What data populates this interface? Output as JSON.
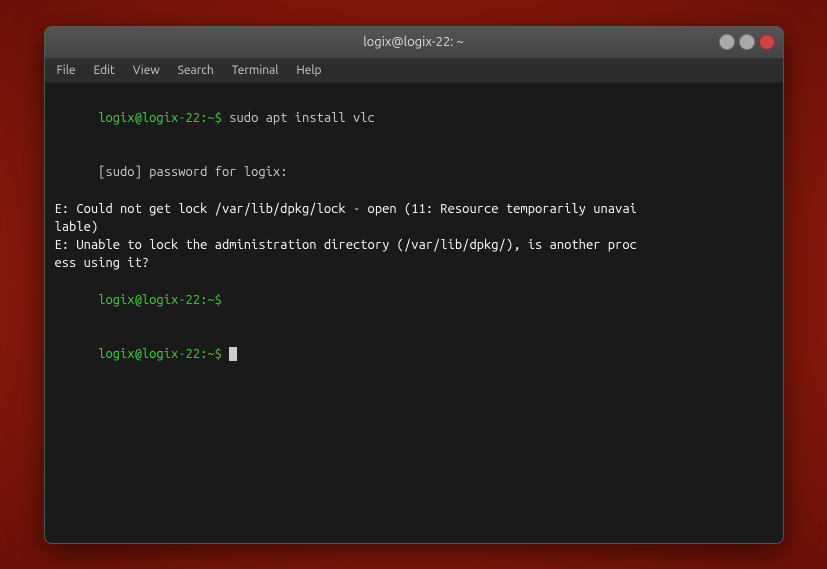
{
  "titlebar": {
    "title": "logix@logix-22: ~"
  },
  "window_controls": {
    "minimize": "–",
    "maximize": "□",
    "close": "✕"
  },
  "menubar": {
    "items": [
      "File",
      "Edit",
      "View",
      "Search",
      "Terminal",
      "Help"
    ]
  },
  "terminal": {
    "lines": [
      {
        "type": "command",
        "prompt": "logix@logix-22:~$",
        "text": " sudo apt install vlc"
      },
      {
        "type": "normal",
        "text": "[sudo] password for logix:"
      },
      {
        "type": "error",
        "text": "E: Could not get lock /var/lib/dpkg/lock - open (11: Resource temporarily unavai\nlable)"
      },
      {
        "type": "error",
        "text": "E: Unable to lock the administration directory (/var/lib/dpkg/), is another proc\ness using it?"
      },
      {
        "type": "prompt_only",
        "prompt": "logix@logix-22:~$"
      },
      {
        "type": "prompt_cursor",
        "prompt": "logix@logix-22:~$"
      }
    ]
  }
}
